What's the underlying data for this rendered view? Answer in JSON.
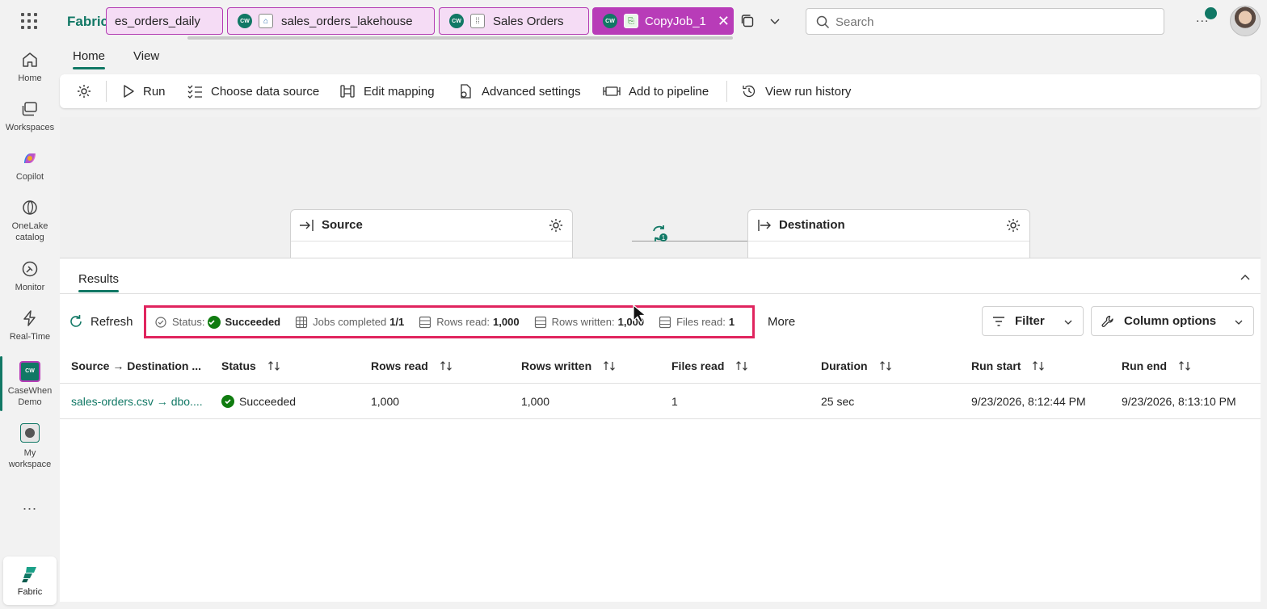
{
  "app": {
    "brand": "Fabric",
    "search_placeholder": "Search",
    "more_label": "...",
    "colors": {
      "accent": "#117865",
      "tab_bg": "#f5dcf5",
      "tab_active_bg": "#b83cb8",
      "highlight": "#e0245e",
      "success": "#107c10"
    }
  },
  "tabs": [
    {
      "label": "es_orders_daily",
      "icon": "pipeline-icon",
      "active": false
    },
    {
      "label": "sales_orders_lakehouse",
      "icon": "lakehouse-icon",
      "workspace": "CW",
      "active": false
    },
    {
      "label": "Sales Orders",
      "icon": "semantic-model-icon",
      "workspace": "CW",
      "active": false
    },
    {
      "label": "CopyJob_1",
      "icon": "copy-job-icon",
      "workspace": "CW",
      "active": true
    }
  ],
  "rail": {
    "items": [
      {
        "label": "Home",
        "icon": "home-icon"
      },
      {
        "label": "Workspaces",
        "icon": "workspaces-icon"
      },
      {
        "label": "Copilot",
        "icon": "copilot-icon"
      },
      {
        "label_1": "OneLake",
        "label_2": "catalog",
        "icon": "onelake-icon"
      },
      {
        "label": "Monitor",
        "icon": "monitor-icon"
      },
      {
        "label": "Real-Time",
        "icon": "real-time-icon"
      },
      {
        "label_1": "CaseWhen",
        "label_2": "Demo",
        "badge": "CW"
      },
      {
        "label_1": "My",
        "label_2": "workspace"
      }
    ],
    "more": "...",
    "fabric_tile": "Fabric"
  },
  "ribbon": {
    "tabs": [
      "Home",
      "View"
    ],
    "buttons": {
      "run": "Run",
      "choose_source": "Choose data source",
      "edit_mapping": "Edit mapping",
      "advanced_settings": "Advanced settings",
      "add_to_pipeline": "Add to pipeline",
      "view_run_history": "View run history"
    }
  },
  "canvas": {
    "source_title": "Source",
    "destination_title": "Destination",
    "badge_count": "1"
  },
  "results": {
    "tab": "Results",
    "refresh": "Refresh",
    "summary": {
      "status_label": "Status:",
      "status_value": "Succeeded",
      "jobs_label": "Jobs completed",
      "jobs_value": "1/1",
      "rows_read_label": "Rows read:",
      "rows_read_value": "1,000",
      "rows_written_label": "Rows written:",
      "rows_written_value": "1,000",
      "files_read_label": "Files read:",
      "files_read_value": "1"
    },
    "more": "More",
    "filter": "Filter",
    "column_options": "Column options",
    "columns": [
      "Source → Destination ...",
      "Status",
      "Rows read",
      "Rows written",
      "Files read",
      "Duration",
      "Run start",
      "Run end"
    ],
    "rows": [
      {
        "source_dest": "sales-orders.csv → dbo....",
        "status": "Succeeded",
        "rows_read": "1,000",
        "rows_written": "1,000",
        "files_read": "1",
        "duration": "25 sec",
        "run_start": "9/23/2026, 8:12:44 PM",
        "run_end": "9/23/2026, 8:13:10 PM"
      }
    ]
  }
}
